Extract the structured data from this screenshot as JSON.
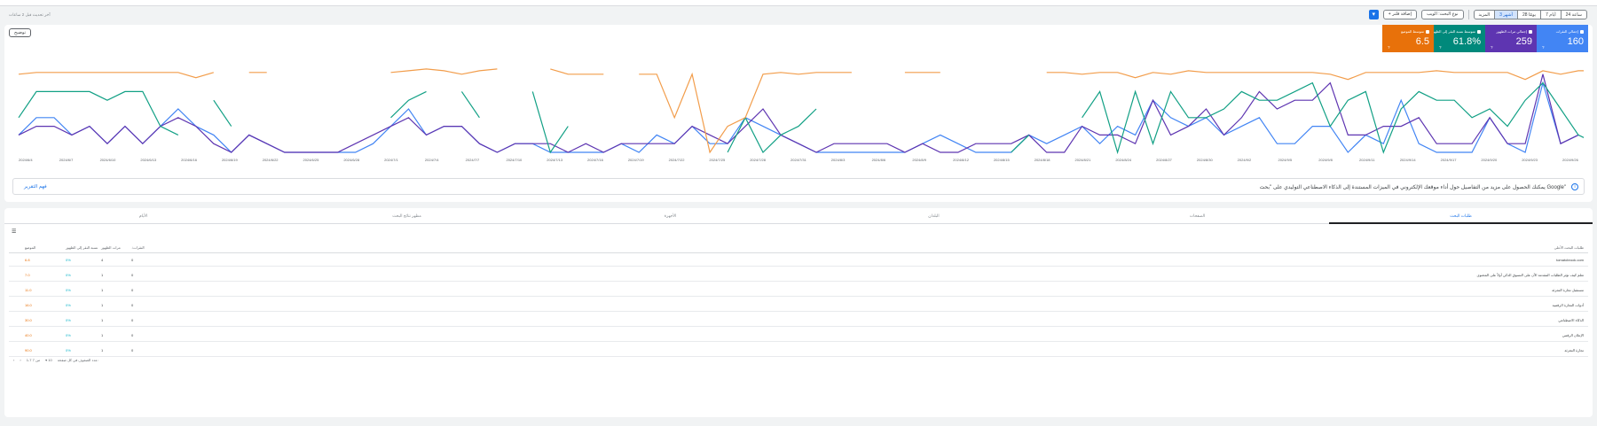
{
  "updated_text": "آخر تحديث قبل 2 ساعات",
  "filters": {
    "date_ranges": [
      {
        "label": "24 ساعة",
        "selected": false
      },
      {
        "label": "7 أيام",
        "selected": false
      },
      {
        "label": "28 يومًا",
        "selected": false
      },
      {
        "label": "3 أشهر",
        "selected": true
      },
      {
        "label": "المزيد",
        "selected": false
      }
    ],
    "search_type": "نوع البحث: الويب",
    "add_filter": "+ إضافة فلتر"
  },
  "legend_button": "توضيح",
  "metrics": [
    {
      "label": "إجمالي النقرات",
      "value": "160",
      "color": "#4285f4"
    },
    {
      "label": "إجمالي مرات الظهور",
      "value": "259",
      "color": "#5e35b1"
    },
    {
      "label": "متوسط نسبة النقر إلى الظهور",
      "value": "61.8%",
      "color": "#00897b"
    },
    {
      "label": "متوسط الموضع",
      "value": "6.5",
      "color": "#e8710a"
    }
  ],
  "chart_data": {
    "type": "line",
    "x": [
      "2024/6/4",
      "2024/6/7",
      "2024/6/10",
      "2024/6/13",
      "2024/6/16",
      "2024/6/19",
      "2024/6/22",
      "2024/6/25",
      "2024/6/28",
      "2024/7/1",
      "2024/7/4",
      "2024/7/7",
      "2024/7/10",
      "2024/7/13",
      "2024/7/16",
      "2024/7/19",
      "2024/7/22",
      "2024/7/25",
      "2024/7/28",
      "2024/7/31",
      "2024/8/3",
      "2024/8/6",
      "2024/8/9",
      "2024/8/12",
      "2024/8/15",
      "2024/8/18",
      "2024/8/21",
      "2024/8/24",
      "2024/8/27",
      "2024/8/30",
      "2024/9/2",
      "2024/9/5",
      "2024/9/8",
      "2024/9/11",
      "2024/9/14",
      "2024/9/17",
      "2024/9/20",
      "2024/9/23",
      "2024/9/26"
    ],
    "series": [
      {
        "color": "#4285f4",
        "values": [
          2,
          4,
          4,
          2,
          3,
          1,
          3,
          1,
          3,
          5,
          3,
          2,
          0,
          2,
          1,
          0,
          0,
          0,
          0,
          0,
          1,
          3,
          5,
          2,
          3,
          3,
          1,
          0,
          1,
          1,
          0,
          0,
          0,
          0,
          1,
          0,
          2,
          1,
          3,
          1,
          1,
          4,
          3,
          2,
          1,
          0,
          0,
          0,
          0,
          0,
          0,
          1,
          2,
          1,
          0,
          0,
          0,
          2,
          1,
          2,
          3,
          1,
          3,
          2,
          6,
          4,
          3,
          4,
          2,
          3,
          4,
          1,
          1,
          3,
          3,
          0,
          2,
          1,
          6,
          1,
          0,
          0,
          0,
          4,
          1,
          0,
          8,
          1,
          2
        ]
      },
      {
        "color": "#5e35b1",
        "values": [
          2,
          3,
          3,
          2,
          3,
          1,
          3,
          1,
          3,
          4,
          3,
          1,
          0,
          2,
          1,
          0,
          0,
          0,
          0,
          1,
          2,
          3,
          4,
          2,
          3,
          3,
          1,
          0,
          1,
          1,
          1,
          0,
          1,
          0,
          1,
          1,
          1,
          1,
          3,
          2,
          1,
          3,
          5,
          2,
          1,
          0,
          1,
          1,
          1,
          1,
          0,
          1,
          0,
          0,
          1,
          1,
          1,
          2,
          0,
          0,
          3,
          2,
          2,
          1,
          6,
          2,
          3,
          5,
          2,
          4,
          7,
          5,
          6,
          6,
          8,
          2,
          2,
          3,
          3,
          4,
          1,
          1,
          1,
          4,
          1,
          1,
          9,
          1,
          2
        ]
      },
      {
        "color": "#12a085",
        "values": [
          4,
          7,
          7,
          7,
          7,
          6,
          7,
          7,
          3,
          2,
          null,
          6,
          3,
          null,
          null,
          null,
          null,
          null,
          null,
          null,
          null,
          4,
          6,
          7,
          null,
          7,
          4,
          null,
          null,
          7,
          0,
          3,
          null,
          null,
          null,
          null,
          null,
          null,
          null,
          null,
          0,
          4,
          0,
          2,
          3,
          5,
          null,
          null,
          null,
          null,
          null,
          null,
          null,
          null,
          null,
          null,
          0,
          2,
          null,
          null,
          4,
          7,
          0,
          7,
          1,
          7,
          4,
          4,
          5,
          7,
          6,
          6,
          7,
          8,
          3,
          6,
          7,
          0,
          5,
          7,
          6,
          6,
          4,
          5,
          3,
          6,
          8,
          5,
          2,
          1
        ]
      },
      {
        "color": "#f29d4b",
        "values": [
          9,
          9.2,
          9.2,
          9.2,
          9.2,
          9.2,
          9.2,
          9.2,
          9.2,
          9.2,
          8.6,
          9.2,
          null,
          9.2,
          9.2,
          null,
          null,
          null,
          null,
          null,
          null,
          9.2,
          9.4,
          9.6,
          9.4,
          9,
          9.4,
          9.6,
          null,
          null,
          9.6,
          9,
          9,
          9,
          null,
          9,
          9,
          4,
          9,
          0,
          3,
          4,
          9,
          9.2,
          9,
          9.2,
          9.2,
          9.2,
          null,
          null,
          9.2,
          9.2,
          9.2,
          null,
          null,
          null,
          null,
          null,
          9.2,
          9.2,
          9,
          9.2,
          9.2,
          8.6,
          9.2,
          9,
          9.4,
          9.2,
          9.2,
          9.2,
          9.2,
          9.2,
          9.2,
          9.2,
          9,
          8.4,
          9.2,
          9.2,
          9.2,
          9.2,
          9.4,
          9.2,
          9.2,
          9.2,
          9.2,
          8.4,
          9.4,
          9,
          9.4,
          9.4
        ]
      }
    ]
  },
  "banner": {
    "text": "يمكنك الحصول على مزيد من التفاصيل حول أداء موقعك الإلكتروني في الميزات المستندة إلى الذكاء الاصطناعي التوليدي على \"بحث Google\"",
    "link": "فهم التقرير"
  },
  "tabs": [
    {
      "label": "طلبات البحث",
      "active": true
    },
    {
      "label": "الصفحات",
      "active": false
    },
    {
      "label": "البلدان",
      "active": false
    },
    {
      "label": "الأجهزة",
      "active": false
    },
    {
      "label": "مظهر نتائج البحث",
      "active": false
    },
    {
      "label": "الأيام",
      "active": false
    }
  ],
  "table": {
    "headers": {
      "name": "طلبات البحث الأعلى",
      "clicks": "النقرات",
      "impressions": "مرات الظهور",
      "ctr": "نسبة النقر إلى الظهور",
      "position": "الموضع"
    },
    "rows": [
      {
        "name": "tomatobrook.com",
        "clicks": "0",
        "impressions": "4",
        "ctr": "0%",
        "position": "6.8"
      },
      {
        "name": "تعلم كيف تؤثر الطلبات المقدمة الآن على التسوق الذكي أولاً على المحتوى",
        "clicks": "0",
        "impressions": "1",
        "ctr": "0%",
        "position": "7.0"
      },
      {
        "name": "مستقبل تجارة التجزئة",
        "clicks": "0",
        "impressions": "1",
        "ctr": "0%",
        "position": "11.0"
      },
      {
        "name": "أدوات التجارة الرقمية",
        "clicks": "0",
        "impressions": "1",
        "ctr": "0%",
        "position": "16.0"
      },
      {
        "name": "الذكاء الاصطناعي",
        "clicks": "0",
        "impressions": "1",
        "ctr": "0%",
        "position": "30.0"
      },
      {
        "name": "الإعلان الرقمي",
        "clicks": "0",
        "impressions": "1",
        "ctr": "0%",
        "position": "40.0"
      },
      {
        "name": "تجارة التجزئة",
        "clicks": "0",
        "impressions": "1",
        "ctr": "0%",
        "position": "90.0"
      }
    ]
  },
  "pagination": {
    "rows_label": "عدد الصفوف في كل صفحة:",
    "rows_value": "10",
    "range": "1-7 من 7"
  }
}
